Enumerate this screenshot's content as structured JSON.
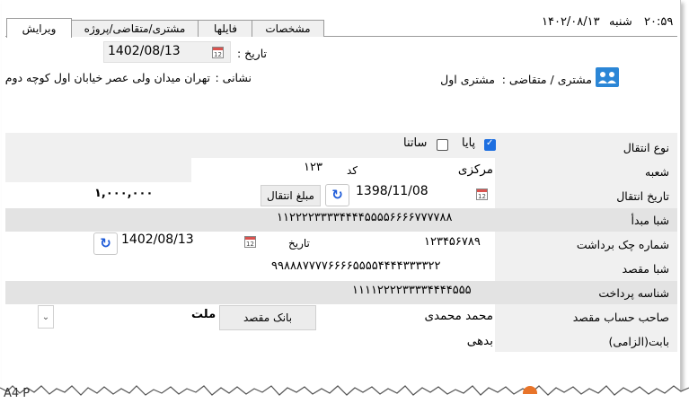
{
  "status_bar": {
    "time": "۲۰:۵۹",
    "day": "شنبه",
    "date": "۱۴۰۲/۰۸/۱۳"
  },
  "tabs": [
    {
      "label": "ویرایش",
      "active": true
    },
    {
      "label": "مشتری/متقاضی/پروژه",
      "active": false
    },
    {
      "label": "فایلها",
      "active": false
    },
    {
      "label": "مشخصات",
      "active": false
    }
  ],
  "header": {
    "date_label": "تاریخ :",
    "date_value": "1402/08/13",
    "customer_label": "مشتری / متقاضی :",
    "customer_value": "مشتری اول",
    "address_label": "نشانی :",
    "address_value": "تهران میدان ولی عصر خیابان اول کوچه دوم"
  },
  "form": {
    "transfer_type": {
      "label": "نوع انتقال",
      "options": [
        {
          "label": "پایا",
          "checked": true
        },
        {
          "label": "ساتنا",
          "checked": false
        }
      ]
    },
    "branch": {
      "label": "شعبه",
      "value": "مرکزی",
      "code_label": "کد",
      "code_value": "۱۲۳"
    },
    "transfer_date": {
      "label": "تاریخ انتقال",
      "value": "1398/11/08",
      "amount_label": "مبلغ انتقال",
      "amount_value": "۱,۰۰۰,۰۰۰"
    },
    "source_sheba": {
      "label": "شبا مبدأ",
      "value": "۱۱۲۲۲۲۳۳۳۳۴۴۴۴۵۵۵۵۶۶۶۶۷۷۷۷۸۸"
    },
    "check_number": {
      "label": "شماره چک برداشت",
      "value": "۱۲۳۴۵۶۷۸۹",
      "date_label": "تاریخ",
      "date_value": "1402/08/13"
    },
    "dest_sheba": {
      "label": "شبا مقصد",
      "value": "۹۹۸۸۸۷۷۷۷۶۶۶۶۵۵۵۵۴۴۴۴۳۳۳۳۲۲"
    },
    "payment_id": {
      "label": "شناسه پرداخت",
      "value": "۱۱۱۱۲۲۲۲۳۳۳۳۴۴۴۴۵۵۵"
    },
    "dest_owner": {
      "label": "صاحب حساب مقصد",
      "value": "محمد محمدی",
      "bank_label": "بانک مقصد",
      "bank_value": "ملت"
    },
    "reason": {
      "label": "بابت(الزامی)",
      "value": "بدهی"
    }
  },
  "footer": {
    "partial_text": "A4 P"
  }
}
